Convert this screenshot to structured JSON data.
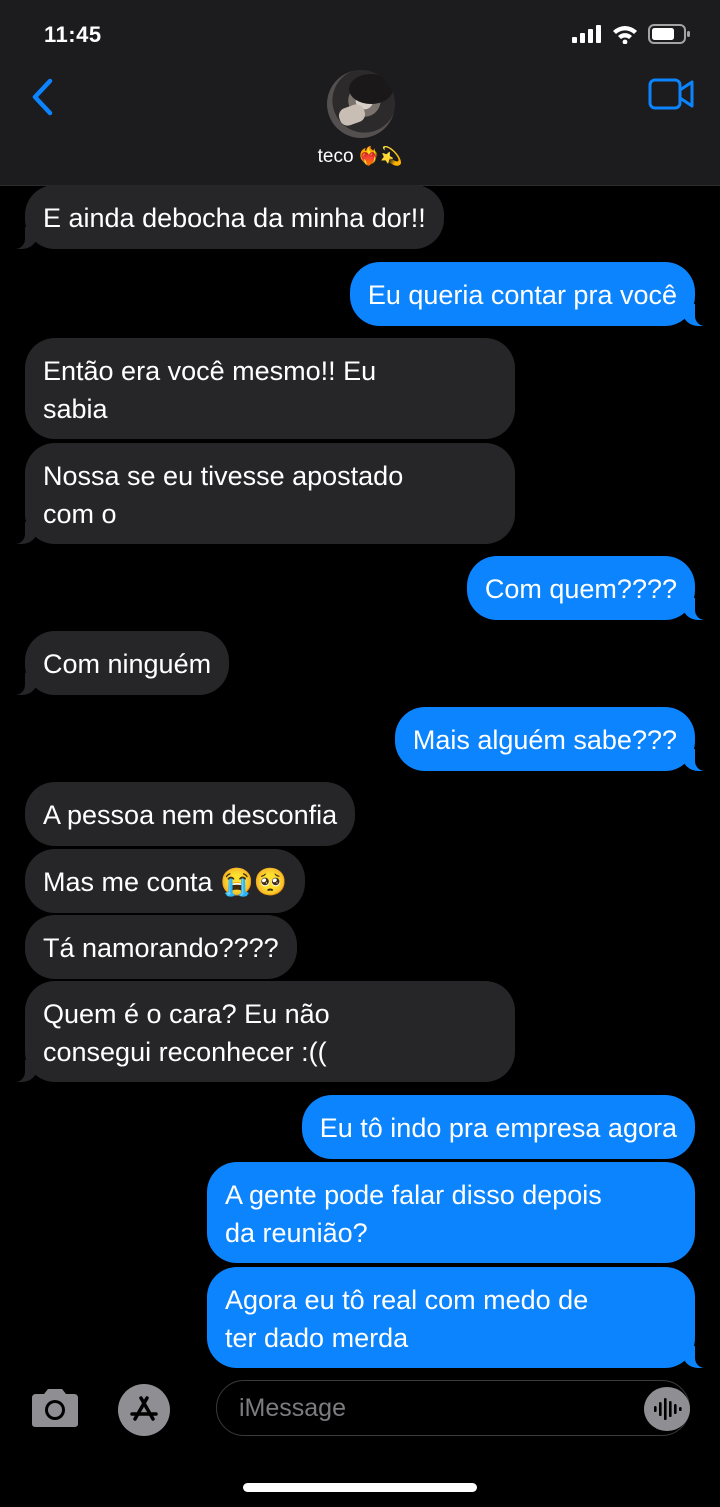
{
  "status_bar": {
    "time": "11:45"
  },
  "header": {
    "contact_name": "teco",
    "contact_emoji": "❤️‍🔥💫"
  },
  "messages": [
    {
      "from": "them",
      "text": "E ainda debocha da minha dor!!"
    },
    {
      "from": "me",
      "text": "Eu queria contar pra você"
    },
    {
      "from": "them",
      "text": "Então era você mesmo!! Eu\nsabia"
    },
    {
      "from": "them",
      "text": "Nossa se eu tivesse apostado\ncom o"
    },
    {
      "from": "me",
      "text": "Com quem????"
    },
    {
      "from": "them",
      "text": "Com ninguém"
    },
    {
      "from": "me",
      "text": "Mais alguém sabe???"
    },
    {
      "from": "them",
      "text": "A pessoa nem desconfia"
    },
    {
      "from": "them",
      "text": "Mas me conta 😭🥺"
    },
    {
      "from": "them",
      "text": "Tá namorando????"
    },
    {
      "from": "them",
      "text": "Quem é o cara? Eu não\nconsegui reconhecer :(("
    },
    {
      "from": "me",
      "text": "Eu tô indo pra empresa agora"
    },
    {
      "from": "me",
      "text": "A gente pode falar disso depois\nda reunião?"
    },
    {
      "from": "me",
      "text": "Agora eu tô real com medo de\nter dado merda"
    }
  ],
  "composer": {
    "placeholder": "iMessage"
  },
  "colors": {
    "incoming_bubble": "#262628",
    "outgoing_bubble": "#0b84fe",
    "accent": "#0b84fe"
  },
  "icons": [
    "back-chevron-icon",
    "video-call-icon",
    "camera-icon",
    "app-store-icon",
    "audio-message-icon",
    "signal-icon",
    "wifi-icon",
    "battery-icon"
  ]
}
